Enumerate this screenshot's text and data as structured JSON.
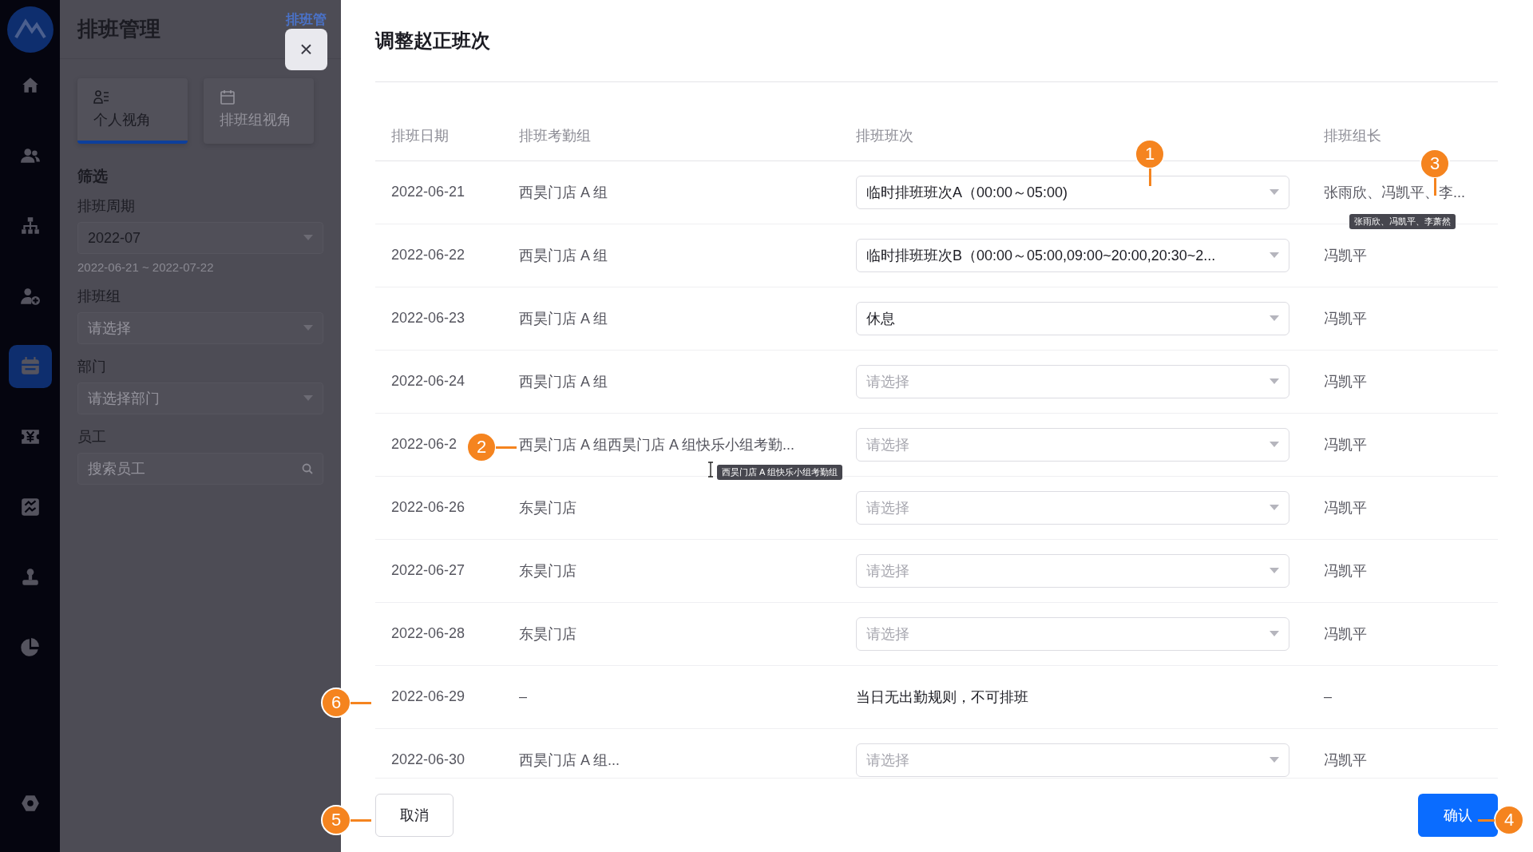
{
  "nav": {
    "items": [
      {
        "kind": "home",
        "selected": false
      },
      {
        "kind": "team",
        "selected": false
      },
      {
        "kind": "org",
        "selected": false
      },
      {
        "kind": "user-add",
        "selected": false
      },
      {
        "kind": "calendar",
        "selected": true
      },
      {
        "kind": "yuan",
        "selected": false
      },
      {
        "kind": "swap",
        "selected": false
      },
      {
        "kind": "stamp",
        "selected": false
      },
      {
        "kind": "pie",
        "selected": false
      }
    ],
    "bottom": [
      {
        "kind": "settings",
        "selected": false
      }
    ]
  },
  "side_panel": {
    "title": "排班管理",
    "clipped_link": "排班管",
    "tabs": [
      {
        "label": "个人视角",
        "kind": "person",
        "selected": true
      },
      {
        "label": "排班组视角",
        "kind": "calendar",
        "selected": false
      }
    ],
    "filter_heading": "筛选",
    "filters": [
      {
        "kind": "select",
        "label": "排班周期",
        "value": "2022-07",
        "hint": "2022-06-21 ~ 2022-07-22"
      },
      {
        "kind": "select",
        "label": "排班组",
        "placeholder": "请选择"
      },
      {
        "kind": "select",
        "label": "部门",
        "placeholder": "请选择部门"
      },
      {
        "kind": "search",
        "label": "员工",
        "placeholder": "搜索员工"
      }
    ]
  },
  "close_button": "×",
  "drawer": {
    "title": "调整赵正班次",
    "table": {
      "columns": [
        "排班日期",
        "排班考勤组",
        "排班班次",
        "排班组长"
      ],
      "rows": [
        {
          "date": "2022-06-21",
          "group": "西昊门店 A 组",
          "shift": {
            "kind": "select",
            "value": "临时排班班次A（00:00～05:00)"
          },
          "leader": "张雨欣、冯凯平、李..."
        },
        {
          "date": "2022-06-22",
          "group": "西昊门店 A 组",
          "shift": {
            "kind": "select",
            "value": "临时排班班次B（00:00～05:00,09:00~20:00,20:30~2..."
          },
          "leader": "冯凯平"
        },
        {
          "date": "2022-06-23",
          "group": "西昊门店 A 组",
          "shift": {
            "kind": "select",
            "value": "休息"
          },
          "leader": "冯凯平"
        },
        {
          "date": "2022-06-24",
          "group": "西昊门店 A 组",
          "shift": {
            "kind": "select",
            "placeholder": "请选择"
          },
          "leader": "冯凯平"
        },
        {
          "date": "2022-06-2",
          "group": "西昊门店 A 组西昊门店 A 组快乐小组考勤...",
          "shift": {
            "kind": "select",
            "placeholder": "请选择"
          },
          "leader": "冯凯平"
        },
        {
          "date": "2022-06-26",
          "group": "东昊门店",
          "shift": {
            "kind": "select",
            "placeholder": "请选择"
          },
          "leader": "冯凯平"
        },
        {
          "date": "2022-06-27",
          "group": "东昊门店",
          "shift": {
            "kind": "select",
            "placeholder": "请选择"
          },
          "leader": "冯凯平"
        },
        {
          "date": "2022-06-28",
          "group": "东昊门店",
          "shift": {
            "kind": "select",
            "placeholder": "请选择"
          },
          "leader": "冯凯平"
        },
        {
          "date": "2022-06-29",
          "group": "–",
          "shift": {
            "kind": "note",
            "text": "当日无出勤规则，不可排班"
          },
          "leader": "–"
        },
        {
          "date": "2022-06-30",
          "group": "西昊门店 A 组...",
          "shift": {
            "kind": "select",
            "placeholder": "请选择"
          },
          "leader": "冯凯平"
        }
      ]
    },
    "cancel_button": "取消",
    "confirm_button": "确认"
  },
  "tooltips": [
    {
      "text": "张雨欣、冯凯平、李萧然"
    },
    {
      "text": "西昊门店 A 组快乐小组考勤组"
    }
  ],
  "callouts": [
    {
      "label": "1"
    },
    {
      "label": "2"
    },
    {
      "label": "3"
    },
    {
      "label": "4"
    },
    {
      "label": "5"
    },
    {
      "label": "6"
    }
  ]
}
